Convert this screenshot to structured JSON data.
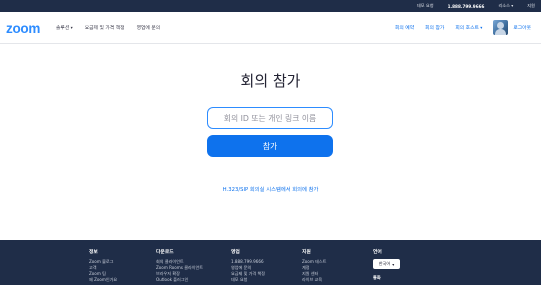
{
  "topbar": {
    "links": [
      "데모 요청",
      "1.888.799.9666",
      "리소스",
      "지원"
    ]
  },
  "navbar": {
    "logo": "zoom",
    "left_items": [
      "솔루션",
      "요금제 및 가격 책정",
      "영업에 문의"
    ],
    "right_items": [
      "회의 예약",
      "회의 참가",
      "회의 호스트"
    ],
    "logout": "로그아웃"
  },
  "main": {
    "title": "회의 참가",
    "input_placeholder": "회의 ID 또는 개인 링크 이름",
    "join_button": "참가",
    "h323_link": "H.323/SIP 회의실 시스템에서 회의에 참가"
  },
  "footer": {
    "columns": [
      {
        "title": "정보",
        "items": [
          "Zoom 블로그",
          "고객",
          "Zoom 팀",
          "왜 Zoom인가요"
        ]
      },
      {
        "title": "다운로드",
        "items": [
          "회의 클라이언트",
          "Zoom Rooms 클라이언트",
          "브라우저 확장",
          "Outlook 플러그인"
        ]
      },
      {
        "title": "영업",
        "items": [
          "1.888.799.9666",
          "영업에 문의",
          "요금제 및 가격 책정",
          "데모 요청"
        ]
      },
      {
        "title": "지원",
        "items": [
          "Zoom 테스트",
          "계정",
          "지원 센터",
          "라이브 교육"
        ]
      }
    ],
    "language": {
      "title": "언어",
      "selected": "한국어"
    },
    "currency_title": "통화"
  },
  "colors": {
    "brand": "#2d8cff",
    "primary_button": "#0e72ed",
    "dark_bar": "#1f2d48"
  }
}
